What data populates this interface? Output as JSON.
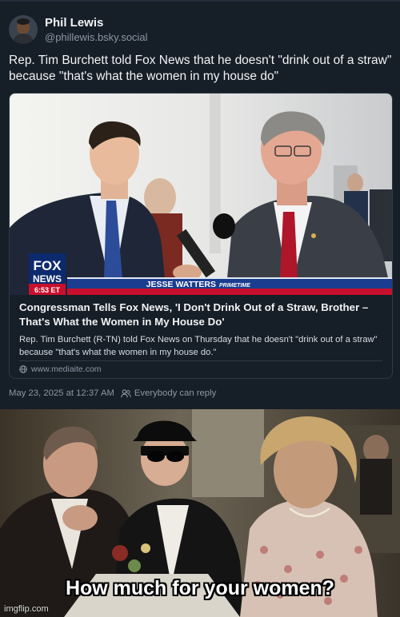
{
  "post": {
    "author": {
      "display_name": "Phil Lewis",
      "handle": "@phillewis.bsky.social"
    },
    "text": "Rep. Tim Burchett told Fox News that he doesn't \"drink out of a straw\" because \"that's what the women in my house do\"",
    "embed": {
      "image": {
        "network_logo_top": "FOX",
        "network_logo_bottom": "NEWS",
        "clock": "6:53 ET",
        "program_name": "JESSE WATTERS",
        "program_tag": "PRIMETIME"
      },
      "title": "Congressman Tells Fox News, 'I Don't Drink Out of a Straw, Brother – That's What the Women in My House Do'",
      "description": "Rep. Tim Burchett (R-TN) told Fox News on Thursday that he doesn't \"drink out of a straw\" because \"that's what the women in my house do.\"",
      "source": "www.mediaite.com",
      "source_icon": "globe-icon"
    },
    "timestamp": "May 23, 2025 at 12:37 AM",
    "reply_setting": "Everybody can reply",
    "reply_icon": "people-icon"
  },
  "meme": {
    "caption": "How much for your women?",
    "watermark": "imgflip.com"
  },
  "colors": {
    "card_bg": "#161e27",
    "text_primary": "#f1f3f5",
    "text_muted": "#8b98a5",
    "border": "#2f3a47",
    "fox_red": "#c8102e",
    "fox_blue": "#1a3d8f"
  }
}
